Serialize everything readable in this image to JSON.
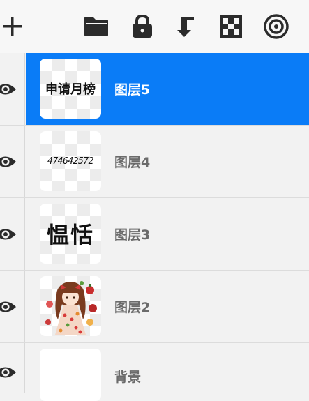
{
  "toolbar": {
    "icons": [
      "add-icon",
      "folder-icon",
      "lock-icon",
      "merge-down-icon",
      "checkerboard-icon",
      "target-icon"
    ]
  },
  "layers": [
    {
      "name": "图层5",
      "thumb_text": "申请月榜",
      "selected": true
    },
    {
      "name": "图层4",
      "thumb_text": "474642572",
      "selected": false
    },
    {
      "name": "图层3",
      "thumb_text": "愠恬",
      "selected": false
    },
    {
      "name": "图层2",
      "thumb_text": "",
      "thumb_kind": "illustration",
      "selected": false
    },
    {
      "name": "背景",
      "thumb_text": "",
      "selected": false
    }
  ],
  "colors": {
    "selected_bg": "#0a7cf7",
    "icon": "#2b2b2b"
  }
}
